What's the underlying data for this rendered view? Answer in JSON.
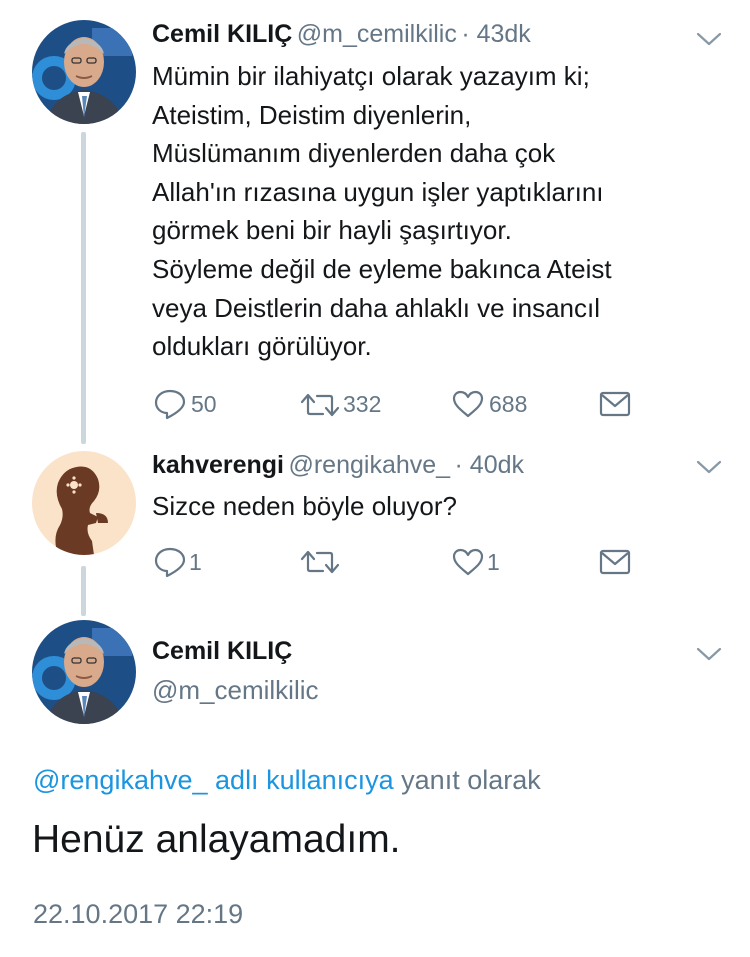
{
  "tweets": [
    {
      "name": "Cemil KILIÇ",
      "handle": "@m_cemilkilic",
      "time": "· 43dk",
      "lines": [
        "Mümin bir ilahiyatçı olarak yazayım ki;",
        "Ateistim, Deistim diyenlerin,",
        "Müslümanım diyenlerden daha çok",
        "Allah'ın rızasına uygun işler yaptıklarını",
        "görmek beni bir hayli şaşırtıyor.",
        "Söyleme değil de eyleme bakınca Ateist",
        "veya Deistlerin daha ahlaklı ve insancıl",
        "oldukları görülüyor."
      ],
      "replies": "50",
      "retweets": "332",
      "likes": "688"
    },
    {
      "name": "kahverengi",
      "handle": "@rengikahve_",
      "time": "· 40dk",
      "lines": [
        "Sizce neden böyle oluyor?"
      ],
      "replies": "1",
      "retweets": "",
      "likes": "1"
    }
  ],
  "main_tweet": {
    "name": "Cemil KILIÇ",
    "handle": "@m_cemilkilic",
    "reply_to_handle": "@rengikahve_",
    "reply_to_suffix": "adlı kullanıcıya",
    "reply_to_tail": "yanıt olarak",
    "text": "Henüz anlayamadım.",
    "timestamp": "22.10.2017 22:19"
  },
  "icons": {
    "reply": "reply-icon",
    "retweet": "retweet-icon",
    "like": "heart-icon",
    "message": "envelope-icon",
    "more": "chevron-down-icon"
  },
  "colors": {
    "text": "#14171a",
    "secondary": "#657786",
    "link": "#1b95e0",
    "thread_line": "#ccd6dd"
  }
}
